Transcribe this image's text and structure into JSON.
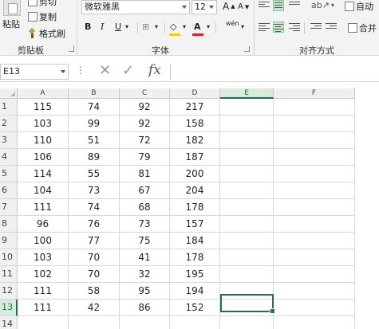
{
  "ribbon": {
    "clipboard": {
      "paste_label": "粘贴",
      "cut_label": "剪切",
      "copy_label": "复制",
      "format_painter_label": "格式刷",
      "group_label": "剪贴板"
    },
    "font": {
      "font_name": "微软雅黑",
      "font_size": "12",
      "grow_label": "A",
      "shrink_label": "A",
      "bold_label": "B",
      "italic_label": "I",
      "underline_label": "U",
      "border_label": "⊞",
      "fill_label": "◇",
      "color_label": "A",
      "phonetic_label": "wén",
      "group_label": "字体",
      "font_color_accent": "#e02020",
      "fill_color_accent": "#f0d000"
    },
    "alignment": {
      "wrap_label": "自动",
      "merge_label": "合并",
      "group_label": "对齐方式"
    }
  },
  "formula_bar": {
    "name_box": "E13",
    "dots": "⋮",
    "cancel_icon": "✕",
    "enter_icon": "✓",
    "fx_label": "fx",
    "formula": ""
  },
  "grid": {
    "columns": [
      "A",
      "B",
      "C",
      "D",
      "E",
      "F"
    ],
    "active_column": "E",
    "active_row": "13",
    "rows": [
      {
        "num": "1",
        "cells": [
          "115",
          "74",
          "92",
          "217",
          "",
          ""
        ]
      },
      {
        "num": "2",
        "cells": [
          "103",
          "99",
          "92",
          "158",
          "",
          ""
        ]
      },
      {
        "num": "3",
        "cells": [
          "110",
          "51",
          "72",
          "182",
          "",
          ""
        ]
      },
      {
        "num": "4",
        "cells": [
          "106",
          "89",
          "79",
          "187",
          "",
          ""
        ]
      },
      {
        "num": "5",
        "cells": [
          "114",
          "55",
          "81",
          "200",
          "",
          ""
        ]
      },
      {
        "num": "6",
        "cells": [
          "104",
          "73",
          "67",
          "204",
          "",
          ""
        ]
      },
      {
        "num": "7",
        "cells": [
          "111",
          "74",
          "68",
          "178",
          "",
          ""
        ]
      },
      {
        "num": "8",
        "cells": [
          "96",
          "76",
          "73",
          "157",
          "",
          ""
        ]
      },
      {
        "num": "9",
        "cells": [
          "100",
          "77",
          "75",
          "184",
          "",
          ""
        ]
      },
      {
        "num": "10",
        "cells": [
          "103",
          "70",
          "41",
          "178",
          "",
          ""
        ]
      },
      {
        "num": "11",
        "cells": [
          "102",
          "70",
          "32",
          "195",
          "",
          ""
        ]
      },
      {
        "num": "12",
        "cells": [
          "111",
          "58",
          "95",
          "194",
          "",
          ""
        ]
      },
      {
        "num": "13",
        "cells": [
          "111",
          "42",
          "86",
          "152",
          "",
          ""
        ]
      },
      {
        "num": "14",
        "cells": [
          "",
          "",
          "",
          "",
          "",
          ""
        ]
      }
    ]
  }
}
